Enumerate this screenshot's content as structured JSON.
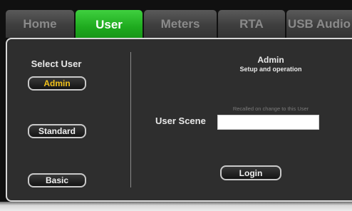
{
  "tabs": [
    {
      "label": "Home",
      "active": false
    },
    {
      "label": "User",
      "active": true
    },
    {
      "label": "Meters",
      "active": false
    },
    {
      "label": "RTA",
      "active": false
    },
    {
      "label": "USB Audio",
      "active": false
    }
  ],
  "select_user": {
    "title": "Select User",
    "users": [
      {
        "label": "Admin",
        "selected": true
      },
      {
        "label": "Standard",
        "selected": false
      },
      {
        "label": "Basic",
        "selected": false
      }
    ]
  },
  "details": {
    "user_name": "Admin",
    "description": "Setup and operation",
    "recall_note": "Recalled on change to this User",
    "scene_label": "User Scene",
    "scene_value": "",
    "login_label": "Login"
  },
  "colors": {
    "active_tab": "#1eaa1e",
    "selected_user_text": "#f2c21b",
    "panel_bg": "#2e2e2e"
  }
}
